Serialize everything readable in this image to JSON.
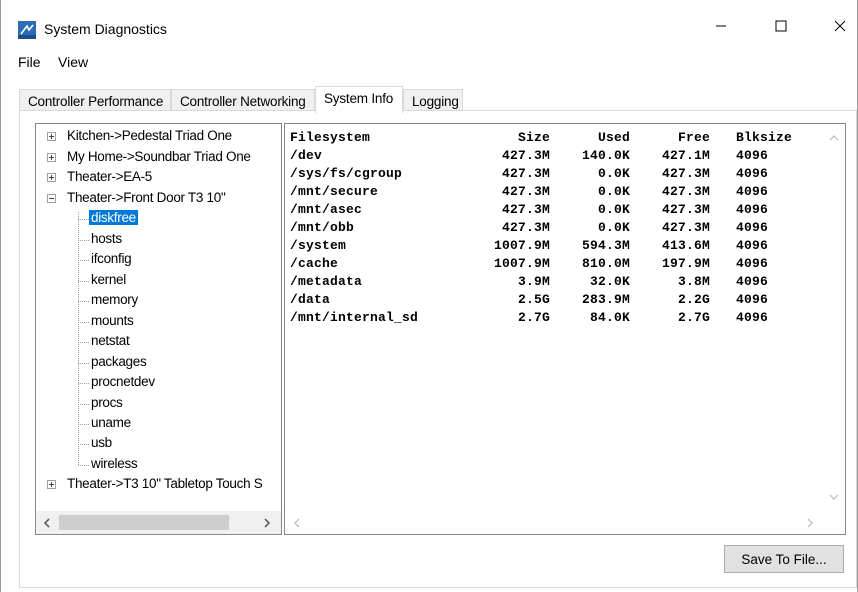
{
  "window": {
    "title": "System Diagnostics",
    "controls": {
      "minimize": "—",
      "maximize": "☐",
      "close": "✕"
    }
  },
  "menu": {
    "items": [
      {
        "label": "File"
      },
      {
        "label": "View"
      }
    ]
  },
  "tabs": [
    {
      "label": "Controller Performance",
      "active": false
    },
    {
      "label": "Controller Networking",
      "active": false
    },
    {
      "label": "System Info",
      "active": true
    },
    {
      "label": "Logging",
      "active": false
    }
  ],
  "tree": {
    "nodes": [
      {
        "label": "Kitchen->Pedestal Triad One",
        "expanded": false
      },
      {
        "label": "My Home->Soundbar Triad One",
        "expanded": false
      },
      {
        "label": "Theater->EA-5",
        "expanded": false
      },
      {
        "label": "Theater->Front Door T3 10\"",
        "expanded": true,
        "children": [
          {
            "label": "diskfree",
            "selected": true
          },
          {
            "label": "hosts"
          },
          {
            "label": "ifconfig"
          },
          {
            "label": "kernel"
          },
          {
            "label": "memory"
          },
          {
            "label": "mounts"
          },
          {
            "label": "netstat"
          },
          {
            "label": "packages"
          },
          {
            "label": "procnetdev"
          },
          {
            "label": "procs"
          },
          {
            "label": "uname"
          },
          {
            "label": "usb"
          },
          {
            "label": "wireless"
          }
        ]
      },
      {
        "label": "Theater->T3 10\" Tabletop Touch S",
        "expanded": false
      }
    ]
  },
  "diskfree": {
    "headers": [
      "Filesystem",
      "Size",
      "Used",
      "Free",
      "Blksize"
    ],
    "rows": [
      [
        "/dev",
        "427.3M",
        "140.0K",
        "427.1M",
        "4096"
      ],
      [
        "/sys/fs/cgroup",
        "427.3M",
        "0.0K",
        "427.3M",
        "4096"
      ],
      [
        "/mnt/secure",
        "427.3M",
        "0.0K",
        "427.3M",
        "4096"
      ],
      [
        "/mnt/asec",
        "427.3M",
        "0.0K",
        "427.3M",
        "4096"
      ],
      [
        "/mnt/obb",
        "427.3M",
        "0.0K",
        "427.3M",
        "4096"
      ],
      [
        "/system",
        "1007.9M",
        "594.3M",
        "413.6M",
        "4096"
      ],
      [
        "/cache",
        "1007.9M",
        "810.0M",
        "197.9M",
        "4096"
      ],
      [
        "/metadata",
        "3.9M",
        "32.0K",
        "3.8M",
        "4096"
      ],
      [
        "/data",
        "2.5G",
        "283.9M",
        "2.2G",
        "4096"
      ],
      [
        "/mnt/internal_sd",
        "2.7G",
        "84.0K",
        "2.7G",
        "4096"
      ]
    ]
  },
  "buttons": {
    "save": "Save To File..."
  },
  "colors": {
    "selection": "#0078d7",
    "accent_icon": "#1e6fc4"
  }
}
